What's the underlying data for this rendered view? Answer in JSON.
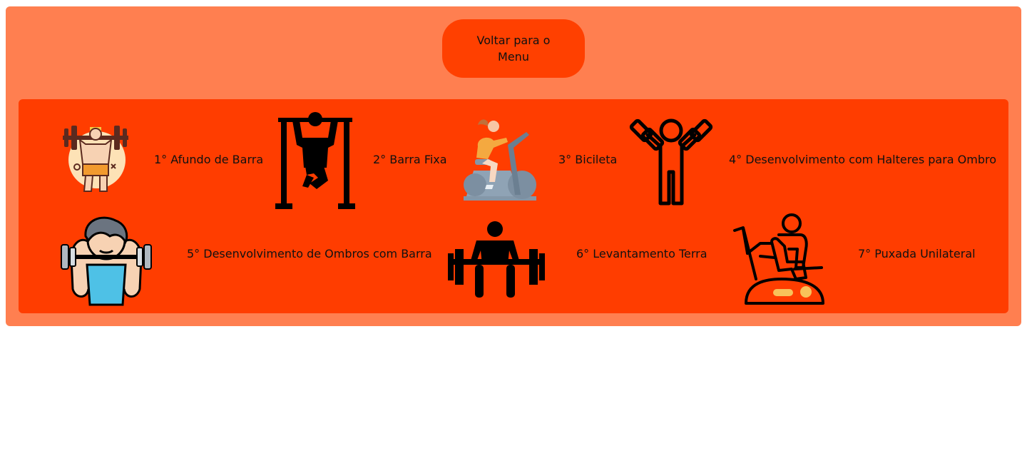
{
  "header": {
    "back_button_label": "Voltar para o Menu"
  },
  "exercises": [
    {
      "label": "1° Afundo de Barra",
      "icon": "barbell-lunge-icon"
    },
    {
      "label": "2° Barra Fixa",
      "icon": "pull-up-bar-icon"
    },
    {
      "label": "3° Bicileta",
      "icon": "exercise-bike-icon"
    },
    {
      "label": "4° Desenvolvimento com Halteres para Ombro",
      "icon": "dumbbell-shoulder-press-icon"
    },
    {
      "label": "5° Desenvolvimento de Ombros com Barra",
      "icon": "barbell-shoulder-press-icon"
    },
    {
      "label": "6° Levantamento Terra",
      "icon": "deadlift-icon"
    },
    {
      "label": "7° Puxada Unilateral",
      "icon": "rowing-machine-icon"
    }
  ],
  "colors": {
    "outer": "#ff7f50",
    "panel": "#ff3d00",
    "button": "#ff4000"
  }
}
